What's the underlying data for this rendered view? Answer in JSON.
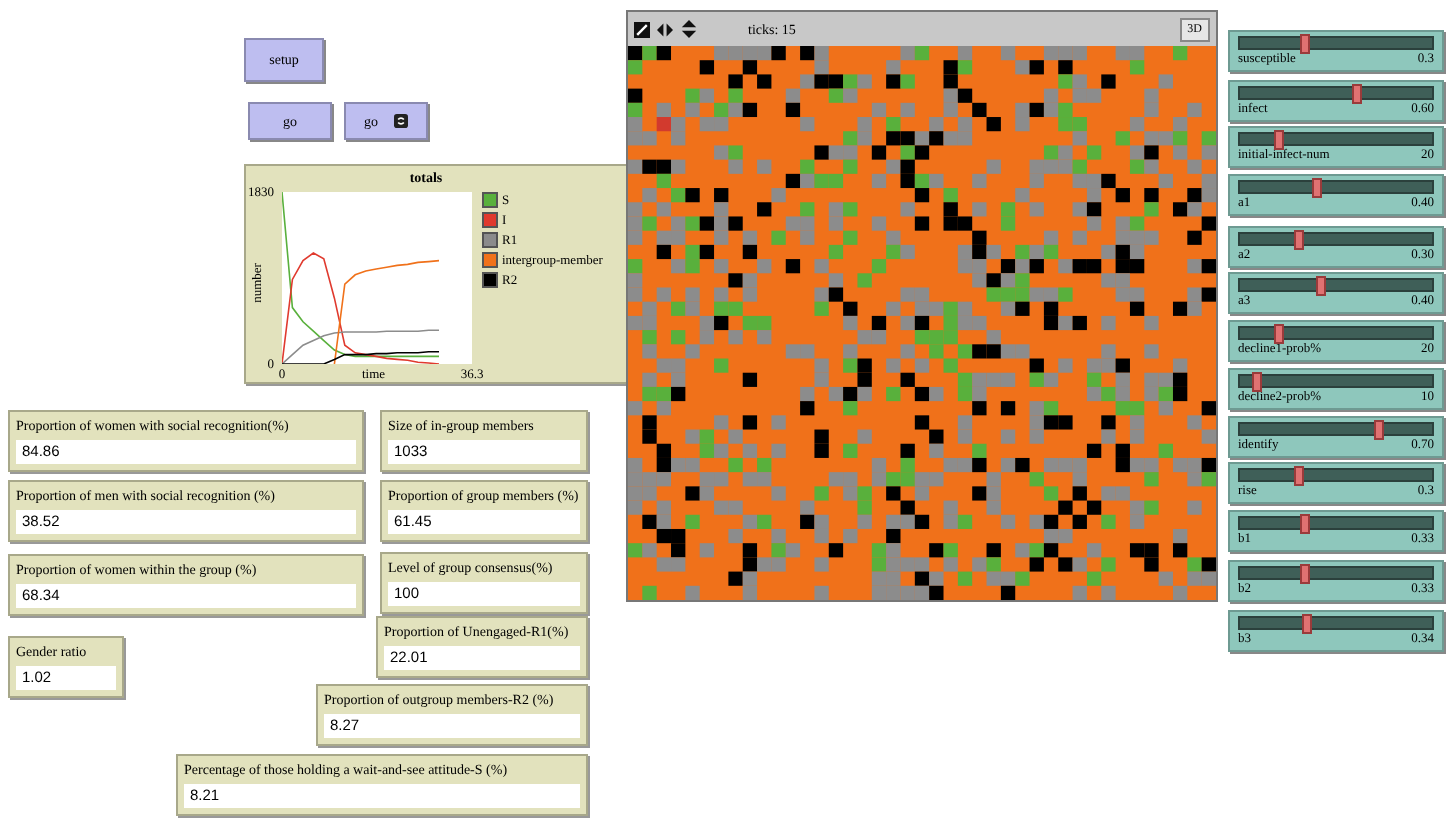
{
  "buttons": [
    {
      "label": "setup",
      "forever": false
    },
    {
      "label": "go",
      "forever": false
    },
    {
      "label": "go",
      "forever": true
    }
  ],
  "plot": {
    "chart_data": {
      "type": "line",
      "title": "totals",
      "legend": "right",
      "xlabel": "time",
      "ylabel": "number",
      "x": [
        0,
        2,
        4,
        6,
        8,
        10,
        12,
        14,
        16,
        18,
        20,
        22,
        24,
        26,
        28,
        30
      ],
      "xlim": [
        0,
        36.3
      ],
      "ylim": [
        0,
        1830
      ],
      "xticks": [
        0,
        36.3
      ],
      "yticks": [
        0,
        1830
      ],
      "series": [
        {
          "name": "S",
          "color": "#59b03c",
          "values": [
            1830,
            600,
            450,
            350,
            250,
            150,
            100,
            80,
            80,
            80,
            80,
            80,
            80,
            80,
            80,
            80
          ]
        },
        {
          "name": "I",
          "color": "#e03a2e",
          "values": [
            0,
            900,
            1100,
            1180,
            1120,
            700,
            200,
            120,
            100,
            80,
            60,
            50,
            40,
            20,
            10,
            0
          ]
        },
        {
          "name": "R1",
          "color": "#8c8c8c",
          "values": [
            0,
            100,
            200,
            250,
            300,
            330,
            340,
            340,
            340,
            340,
            350,
            350,
            350,
            350,
            360,
            360
          ]
        },
        {
          "name": "intergroup-member",
          "color": "#f0711a",
          "values": [
            null,
            null,
            null,
            null,
            null,
            0,
            850,
            950,
            990,
            1010,
            1030,
            1050,
            1060,
            1080,
            1090,
            1100
          ]
        },
        {
          "name": "R2",
          "color": "#000000",
          "values": [
            0,
            0,
            0,
            0,
            0,
            50,
            100,
            100,
            100,
            110,
            110,
            120,
            120,
            120,
            130,
            130
          ]
        }
      ]
    }
  },
  "monitors": [
    {
      "label": "Proportion of women with social recognition(%)",
      "value": "84.86"
    },
    {
      "label": "Size of in-group members",
      "value": "1033"
    },
    {
      "label": "Proportion of men with social recognition (%)",
      "value": "38.52"
    },
    {
      "label": "Proportion of group members (%)",
      "value": "61.45"
    },
    {
      "label": "Proportion of women within the group (%)",
      "value": "68.34"
    },
    {
      "label": "Level of group consensus(%)",
      "value": "100"
    },
    {
      "label": "Proportion of Unengaged-R1(%)",
      "value": "22.01"
    },
    {
      "label": "Gender ratio",
      "value": "1.02"
    },
    {
      "label": "Proportion of outgroup members-R2 (%)",
      "value": "8.27"
    },
    {
      "label": "Percentage of those holding a wait-and-see attitude-S (%)",
      "value": "8.21"
    }
  ],
  "world": {
    "ticks": "ticks: 15",
    "button_3d": "3D"
  },
  "sliders": [
    {
      "name": "susceptible",
      "value": "0.3",
      "level": 0.33
    },
    {
      "name": "infect",
      "value": "0.60",
      "level": 0.6
    },
    {
      "name": "initial-infect-num",
      "value": "20",
      "level": 0.2
    },
    {
      "name": "a1",
      "value": "0.40",
      "level": 0.4
    },
    {
      "name": "a2",
      "value": "0.30",
      "level": 0.3
    },
    {
      "name": "a3",
      "value": "0.40",
      "level": 0.42
    },
    {
      "name": "decline1-prob%",
      "value": "20",
      "level": 0.2
    },
    {
      "name": "decline2-prob%",
      "value": "10",
      "level": 0.08
    },
    {
      "name": "identify",
      "value": "0.70",
      "level": 0.72
    },
    {
      "name": "rise",
      "value": "0.3",
      "level": 0.3
    },
    {
      "name": "b1",
      "value": "0.33",
      "level": 0.33
    },
    {
      "name": "b2",
      "value": "0.33",
      "level": 0.33
    },
    {
      "name": "b3",
      "value": "0.34",
      "level": 0.34
    }
  ]
}
